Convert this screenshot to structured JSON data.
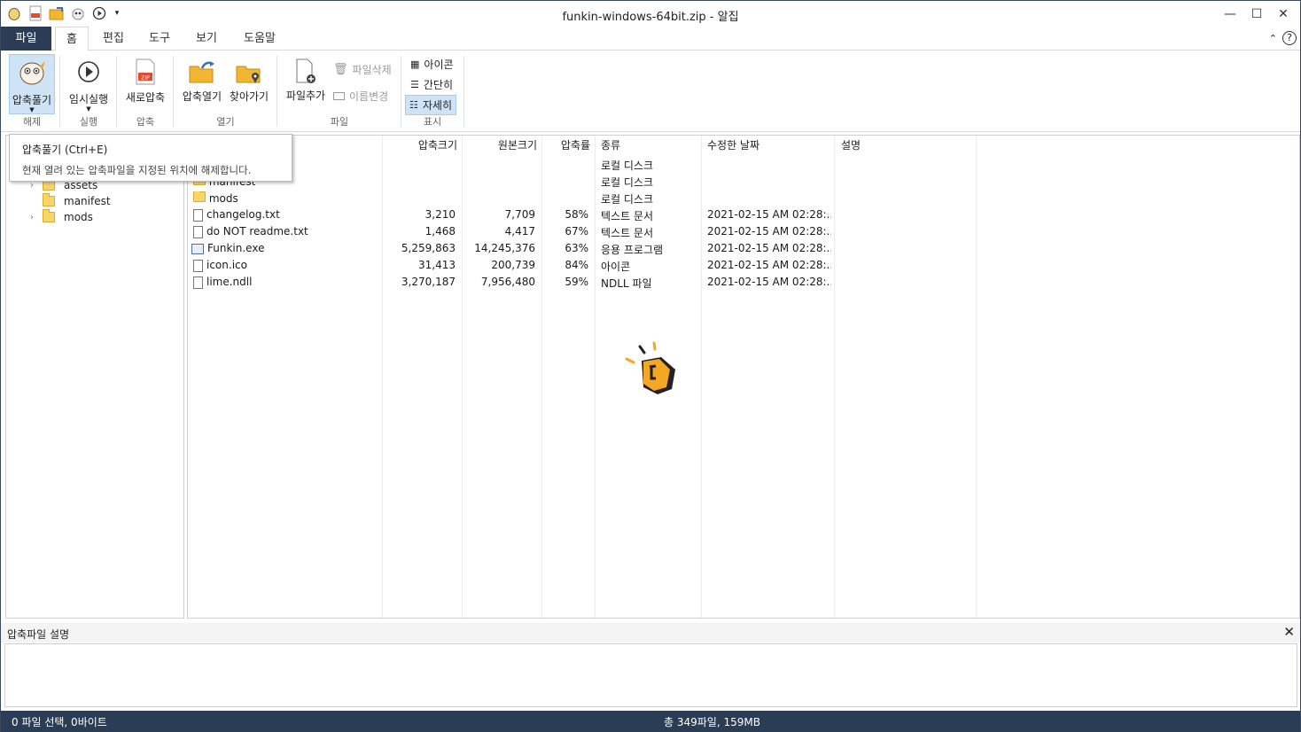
{
  "window": {
    "title": "funkin-windows-64bit.zip - 알집"
  },
  "menu_tabs": [
    "파일",
    "홈",
    "편집",
    "도구",
    "보기",
    "도움말"
  ],
  "ribbon": {
    "extract": "압축풀기",
    "run_temp": "임시실행",
    "new_archive": "새로압축",
    "open_archive": "압축열기",
    "browse": "찾아가기",
    "add_file": "파일추가",
    "delete_file": "파일삭제",
    "rename": "이름변경",
    "view_icon": "아이콘",
    "view_simple": "간단히",
    "view_detail": "자세히",
    "group_extract": "해제",
    "group_run": "실행",
    "group_compress": "압축",
    "group_open": "열기",
    "group_file": "파일",
    "group_view": "표시"
  },
  "tooltip": {
    "title": "압축풀기 (Ctrl+E)",
    "body": "현재 열려 있는 압축파일을 지정된 위치에 해제합니다."
  },
  "tree": {
    "items": [
      {
        "label": "assets"
      },
      {
        "label": "manifest"
      },
      {
        "label": "mods"
      }
    ]
  },
  "columns": {
    "name": "",
    "packed": "압축크기",
    "original": "원본크기",
    "ratio": "압축률",
    "type": "종류",
    "modified": "수정한 날짜",
    "desc": "설명"
  },
  "rows": [
    {
      "name": "",
      "packed": "",
      "original": "",
      "ratio": "",
      "type": "로컬 디스크",
      "modified": ""
    },
    {
      "name": "manifest",
      "packed": "",
      "original": "",
      "ratio": "",
      "type": "로컬 디스크",
      "modified": ""
    },
    {
      "name": "mods",
      "packed": "",
      "original": "",
      "ratio": "",
      "type": "로컬 디스크",
      "modified": ""
    },
    {
      "name": "changelog.txt",
      "packed": "3,210",
      "original": "7,709",
      "ratio": "58%",
      "type": "텍스트 문서",
      "modified": "2021-02-15 AM 02:28:..."
    },
    {
      "name": "do NOT readme.txt",
      "packed": "1,468",
      "original": "4,417",
      "ratio": "67%",
      "type": "텍스트 문서",
      "modified": "2021-02-15 AM 02:28:..."
    },
    {
      "name": "Funkin.exe",
      "packed": "5,259,863",
      "original": "14,245,376",
      "ratio": "63%",
      "type": "응용 프로그램",
      "modified": "2021-02-15 AM 02:28:..."
    },
    {
      "name": "icon.ico",
      "packed": "31,413",
      "original": "200,739",
      "ratio": "84%",
      "type": "아이콘",
      "modified": "2021-02-15 AM 02:28:..."
    },
    {
      "name": "lime.ndll",
      "packed": "3,270,187",
      "original": "7,956,480",
      "ratio": "59%",
      "type": "NDLL 파일",
      "modified": "2021-02-15 AM 02:28:..."
    }
  ],
  "description_pane": {
    "title": "압축파일 설명"
  },
  "status": {
    "selection": "0 파일 선택,  0바이트",
    "total": "총 349파일,  159MB"
  },
  "colors": {
    "accent": "#2b3d55",
    "selected": "#cfe3f7",
    "folder": "#f9d466",
    "logo": "#f5a623"
  }
}
